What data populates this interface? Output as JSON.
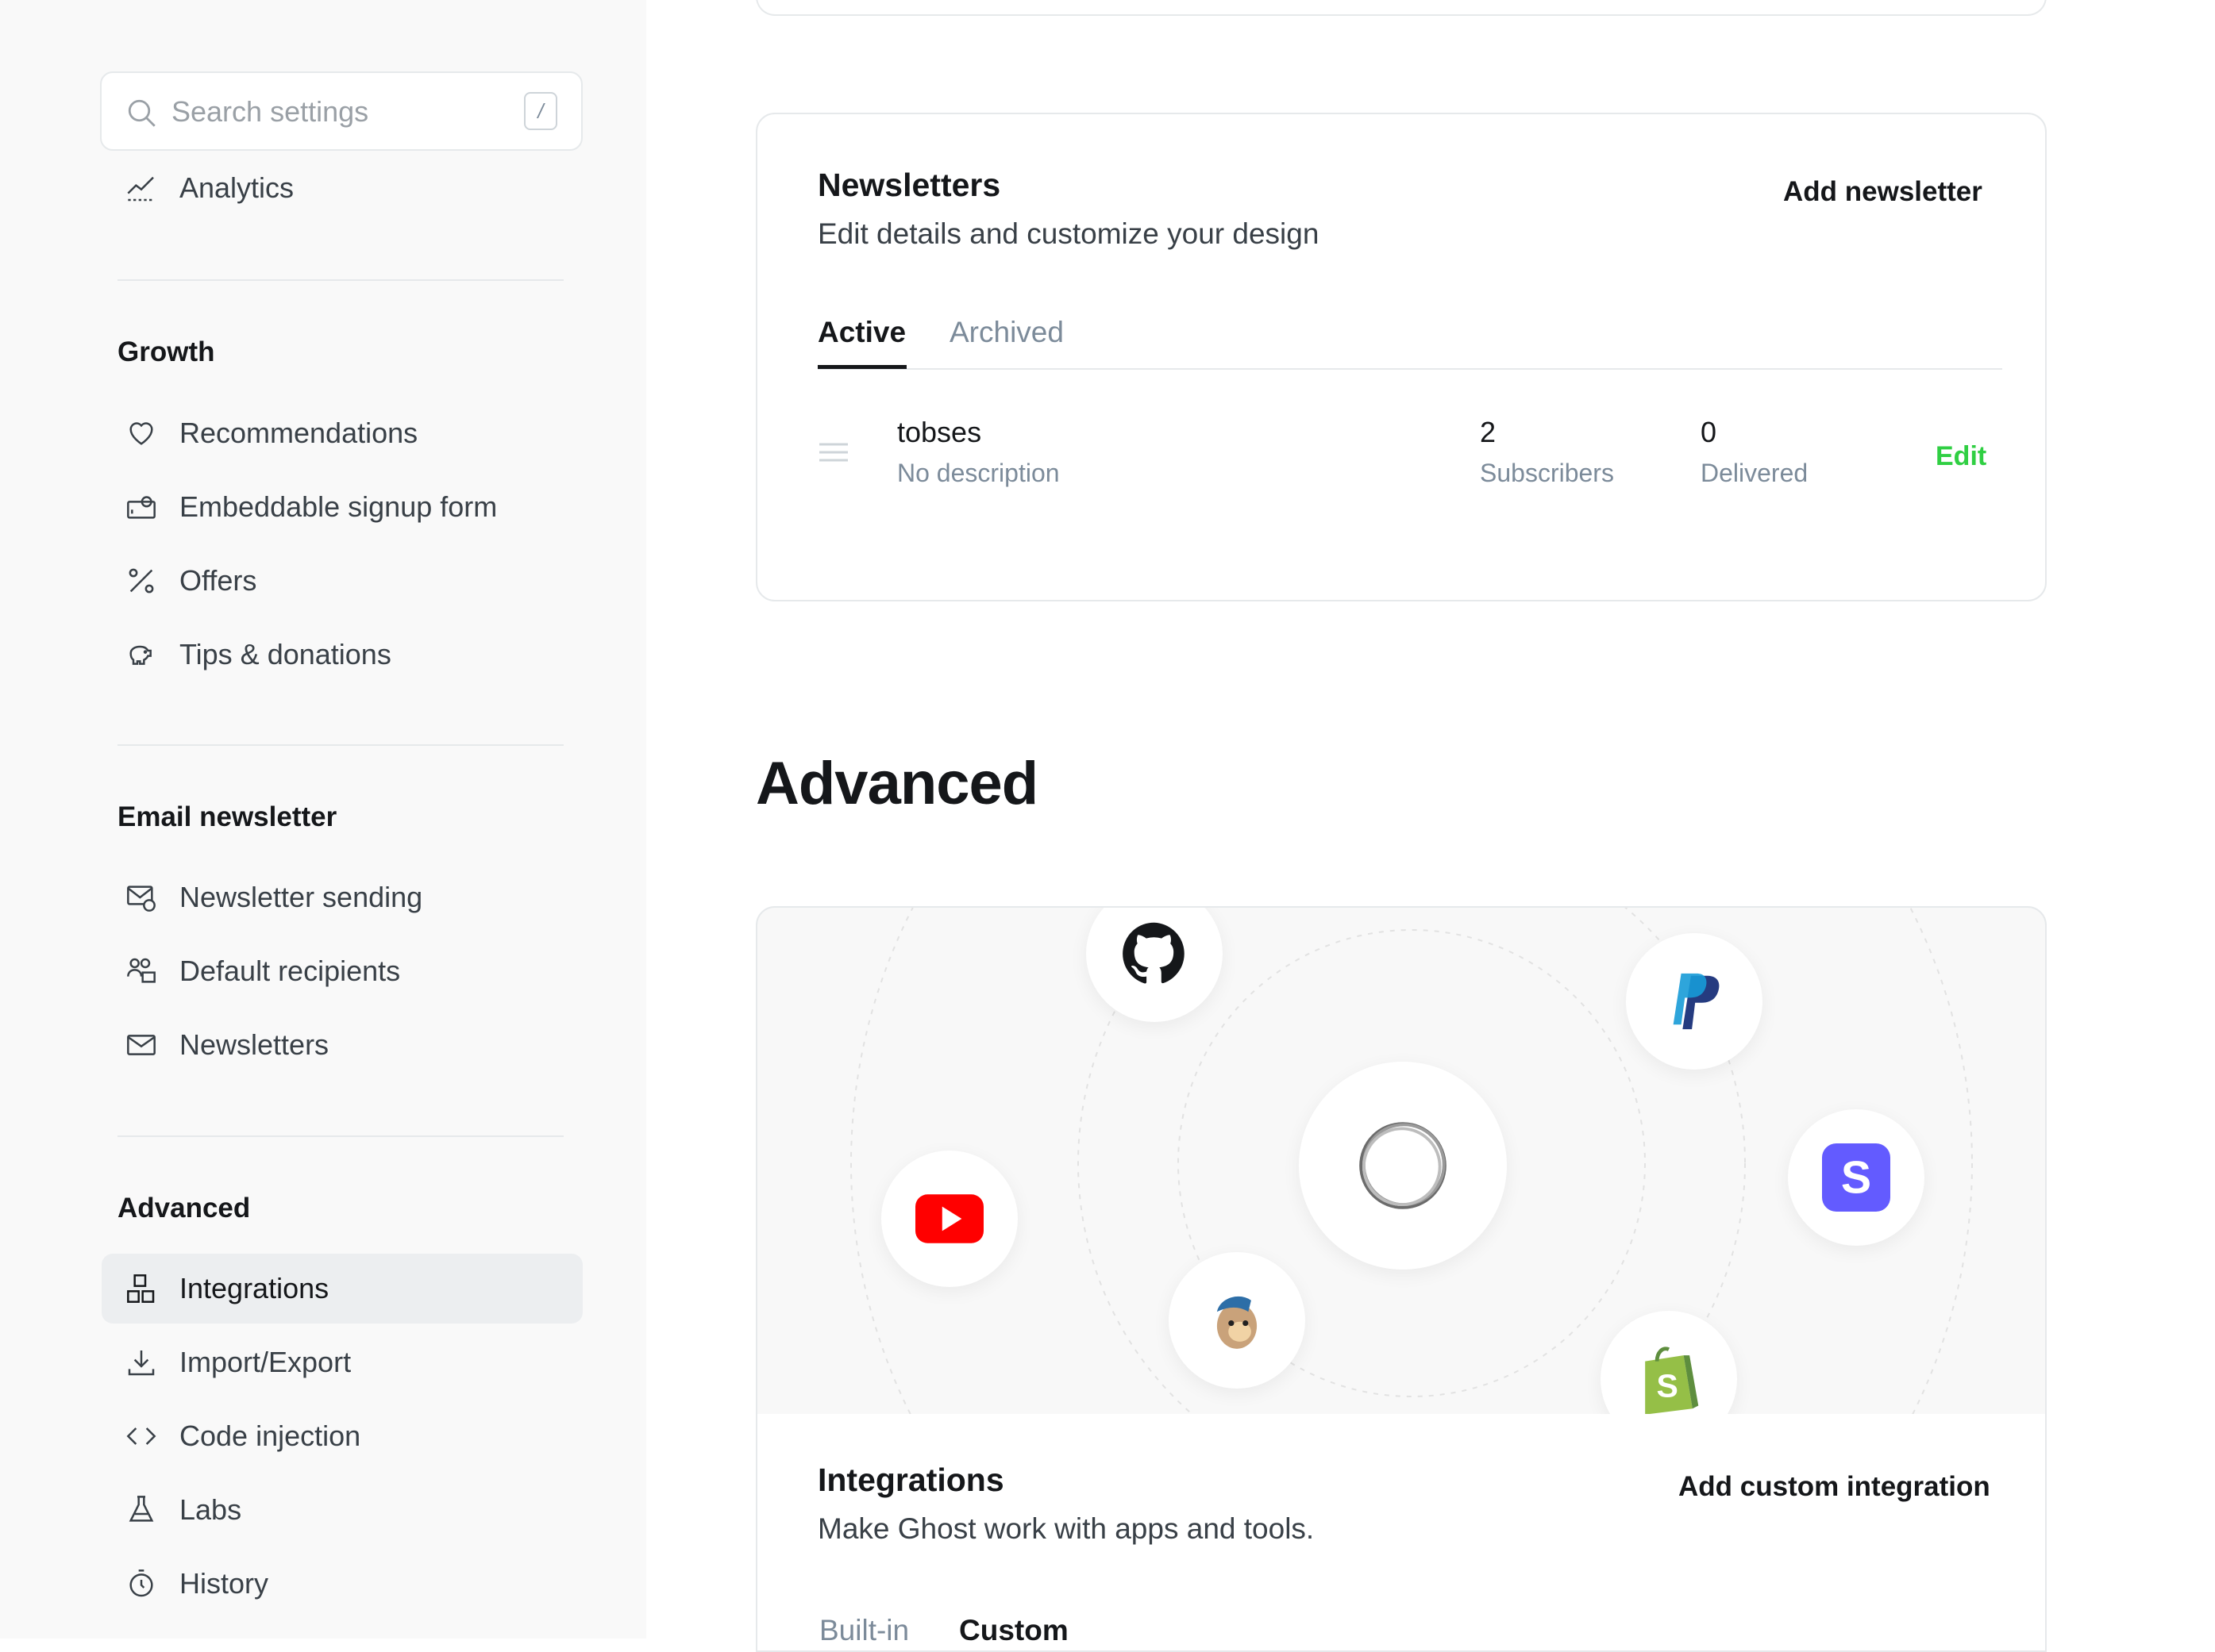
{
  "sidebar": {
    "search": {
      "placeholder": "Search settings",
      "shortcut": "/"
    },
    "top_items": [
      {
        "label": "Analytics",
        "icon": "analytics-icon"
      }
    ],
    "groups": [
      {
        "title": "Growth",
        "items": [
          {
            "label": "Recommendations",
            "icon": "heart-icon"
          },
          {
            "label": "Embeddable signup form",
            "icon": "signup-form-icon"
          },
          {
            "label": "Offers",
            "icon": "percent-icon"
          },
          {
            "label": "Tips & donations",
            "icon": "piggy-bank-icon"
          }
        ]
      },
      {
        "title": "Email newsletter",
        "items": [
          {
            "label": "Newsletter sending",
            "icon": "mail-settings-icon"
          },
          {
            "label": "Default recipients",
            "icon": "recipients-icon"
          },
          {
            "label": "Newsletters",
            "icon": "envelope-icon"
          }
        ]
      },
      {
        "title": "Advanced",
        "items": [
          {
            "label": "Integrations",
            "icon": "integrations-icon",
            "active": true
          },
          {
            "label": "Import/Export",
            "icon": "download-icon"
          },
          {
            "label": "Code injection",
            "icon": "code-icon"
          },
          {
            "label": "Labs",
            "icon": "flask-icon"
          },
          {
            "label": "History",
            "icon": "history-icon"
          }
        ]
      }
    ]
  },
  "newsletters": {
    "title": "Newsletters",
    "description": "Edit details and customize your design",
    "add_label": "Add newsletter",
    "tabs": [
      {
        "label": "Active",
        "selected": true
      },
      {
        "label": "Archived",
        "selected": false
      }
    ],
    "rows": [
      {
        "name": "tobses",
        "description": "No description",
        "subscribers": "2",
        "subscribers_label": "Subscribers",
        "delivered": "0",
        "delivered_label": "Delivered",
        "edit_label": "Edit"
      }
    ]
  },
  "advanced": {
    "heading": "Advanced",
    "integrations": {
      "title": "Integrations",
      "description": "Make Ghost work with apps and tools.",
      "add_label": "Add custom integration",
      "tabs": [
        {
          "label": "Built-in",
          "selected": false
        },
        {
          "label": "Custom",
          "selected": true
        }
      ],
      "hero_icons": [
        "github-icon",
        "paypal-icon",
        "ghost-ring-icon",
        "youtube-icon",
        "stripe-icon",
        "mailchimp-icon",
        "shopify-icon"
      ]
    }
  },
  "colors": {
    "accent_green": "#30cf43",
    "active_nav_bg": "#eceef0",
    "sidebar_bg": "#f9f9f9"
  }
}
